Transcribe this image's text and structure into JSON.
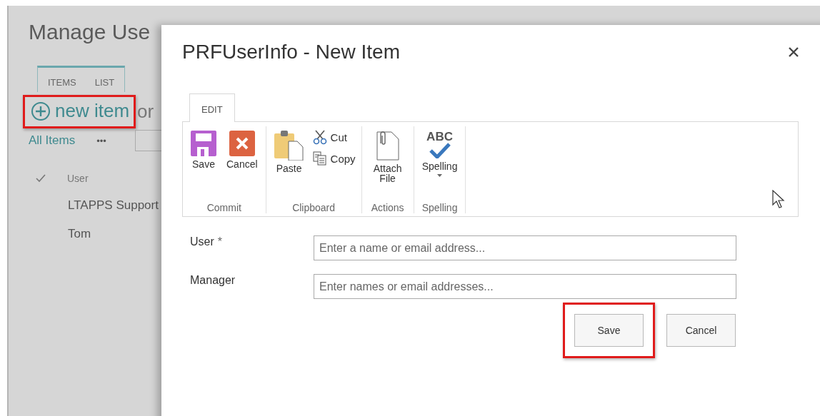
{
  "page": {
    "title": "Manage Use",
    "tabs": [
      {
        "label": "ITEMS"
      },
      {
        "label": "LIST"
      }
    ],
    "new_item": {
      "label": "new item",
      "highlighted": true
    },
    "or_text": "or",
    "view": "All Items",
    "more": "•••",
    "column_header": "User",
    "rows": [
      "LTAPPS Support",
      "Tom"
    ]
  },
  "dialog": {
    "title": "PRFUserInfo - New Item",
    "ribbon_tabs": [
      {
        "label": "EDIT",
        "selected": true
      }
    ],
    "groups": [
      {
        "label": "Commit",
        "buttons": [
          {
            "kind": "save",
            "label": "Save"
          },
          {
            "kind": "cancel",
            "label": "Cancel"
          }
        ]
      },
      {
        "label": "Clipboard",
        "buttons": [
          {
            "kind": "paste",
            "label": "Paste"
          },
          {
            "kind": "cut",
            "label": "Cut"
          },
          {
            "kind": "copy",
            "label": "Copy"
          }
        ]
      },
      {
        "label": "Actions",
        "buttons": [
          {
            "kind": "attach",
            "label": "Attach File"
          }
        ]
      },
      {
        "label": "Spelling",
        "buttons": [
          {
            "kind": "spelling",
            "label": "Spelling",
            "icon_text": "ABC"
          }
        ]
      }
    ],
    "required_mark": "*",
    "fields": [
      {
        "label": "User",
        "required": true,
        "placeholder": "Enter a name or email address..."
      },
      {
        "label": "Manager",
        "required": false,
        "placeholder": "Enter names or email addresses..."
      }
    ],
    "buttons": [
      {
        "label": "Save",
        "highlighted": true
      },
      {
        "label": "Cancel",
        "highlighted": false
      }
    ]
  }
}
